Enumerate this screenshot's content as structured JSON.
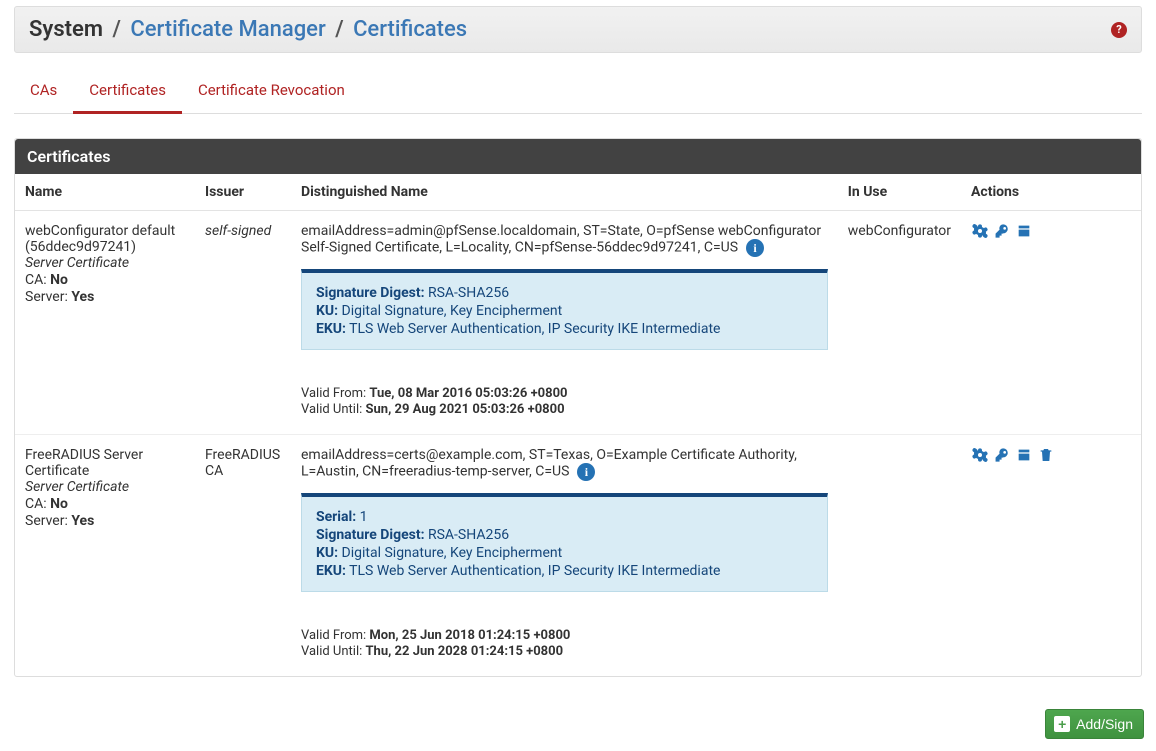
{
  "breadcrumb": {
    "root": "System",
    "section": "Certificate Manager",
    "page": "Certificates"
  },
  "tabs": [
    {
      "label": "CAs",
      "active": false
    },
    {
      "label": "Certificates",
      "active": true
    },
    {
      "label": "Certificate Revocation",
      "active": false
    }
  ],
  "panel_title": "Certificates",
  "columns": {
    "name": "Name",
    "issuer": "Issuer",
    "dn": "Distinguished Name",
    "inuse": "In Use",
    "actions": "Actions"
  },
  "rows": [
    {
      "name": "webConfigurator default (56ddec9d97241)",
      "type": "Server Certificate",
      "ca_label": "CA:",
      "ca_value": "No",
      "server_label": "Server:",
      "server_value": "Yes",
      "issuer": "self-signed",
      "dn": "emailAddress=admin@pfSense.localdomain, ST=State, O=pfSense webConfigurator Self-Signed Certificate, L=Locality, CN=pfSense-56ddec9d97241, C=US",
      "info": [
        {
          "label": "Signature Digest:",
          "value": "RSA-SHA256"
        },
        {
          "label": "KU:",
          "value": "Digital Signature, Key Encipherment"
        },
        {
          "label": "EKU:",
          "value": "TLS Web Server Authentication, IP Security IKE Intermediate"
        }
      ],
      "valid_from_label": "Valid From:",
      "valid_from": "Tue, 08 Mar 2016 05:03:26 +0800",
      "valid_until_label": "Valid Until:",
      "valid_until": "Sun, 29 Aug 2021 05:03:26 +0800",
      "in_use": "webConfigurator",
      "actions": [
        "edit",
        "key",
        "export"
      ]
    },
    {
      "name": "FreeRADIUS Server Certificate",
      "type": "Server Certificate",
      "ca_label": "CA:",
      "ca_value": "No",
      "server_label": "Server:",
      "server_value": "Yes",
      "issuer": "FreeRADIUS CA",
      "dn": "emailAddress=certs@example.com, ST=Texas, O=Example Certificate Authority, L=Austin, CN=freeradius-temp-server, C=US",
      "info": [
        {
          "label": "Serial:",
          "value": "1"
        },
        {
          "label": "Signature Digest:",
          "value": "RSA-SHA256"
        },
        {
          "label": "KU:",
          "value": "Digital Signature, Key Encipherment"
        },
        {
          "label": "EKU:",
          "value": "TLS Web Server Authentication, IP Security IKE Intermediate"
        }
      ],
      "valid_from_label": "Valid From:",
      "valid_from": "Mon, 25 Jun 2018 01:24:15 +0800",
      "valid_until_label": "Valid Until:",
      "valid_until": "Thu, 22 Jun 2028 01:24:15 +0800",
      "in_use": "",
      "actions": [
        "edit",
        "key",
        "export",
        "delete"
      ]
    }
  ],
  "add_button": "Add/Sign"
}
